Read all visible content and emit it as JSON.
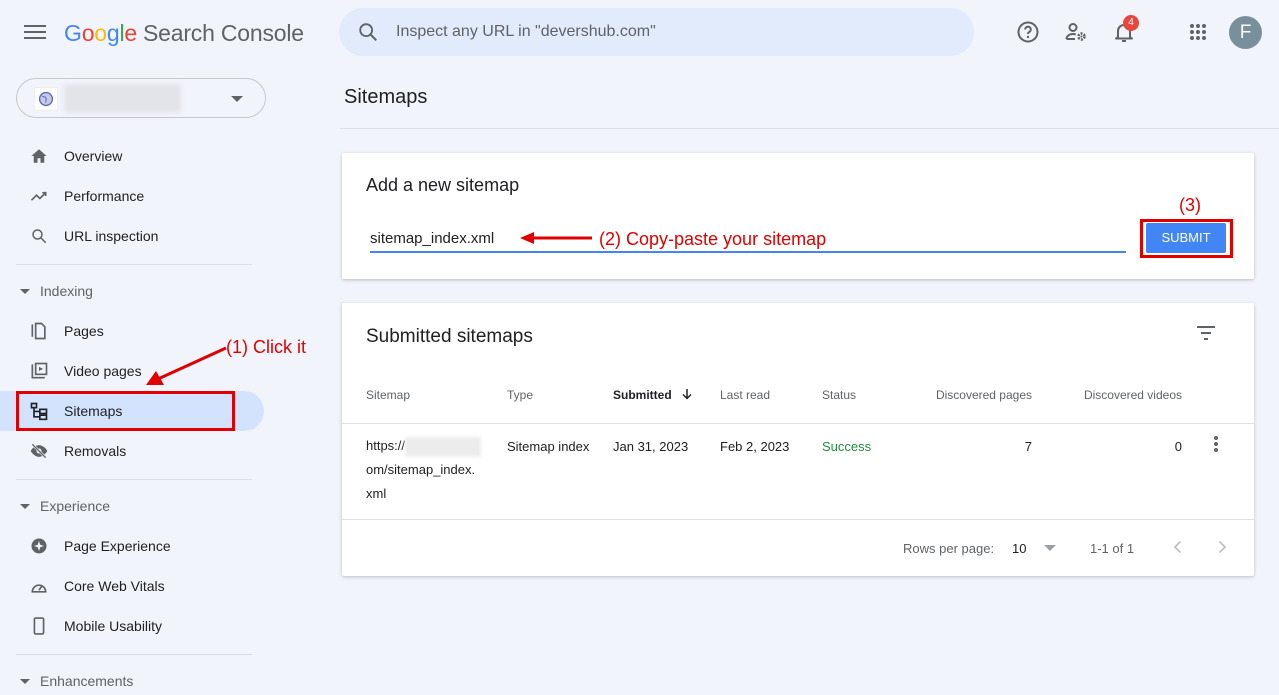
{
  "header": {
    "logo_google": [
      "G",
      "o",
      "o",
      "g",
      "l",
      "e"
    ],
    "logo_product": "Search Console",
    "search_placeholder": "Inspect any URL in \"devershub.com\"",
    "notification_count": "4",
    "avatar_initial": "F",
    "icons": [
      "menu-icon",
      "search-icon",
      "help-icon",
      "manage-users-icon",
      "notifications-icon",
      "apps-icon"
    ]
  },
  "property_selector": {
    "icon": "globe-icon",
    "value_obscured": true
  },
  "sidebar": {
    "items_top": [
      {
        "label": "Overview",
        "icon": "home-icon"
      },
      {
        "label": "Performance",
        "icon": "trending-up-icon"
      },
      {
        "label": "URL inspection",
        "icon": "search-icon"
      }
    ],
    "sections": [
      {
        "label": "Indexing",
        "items": [
          {
            "label": "Pages",
            "icon": "pages-icon"
          },
          {
            "label": "Video pages",
            "icon": "video-pages-icon"
          },
          {
            "label": "Sitemaps",
            "icon": "sitemap-icon",
            "active": true
          },
          {
            "label": "Removals",
            "icon": "removals-icon"
          }
        ]
      },
      {
        "label": "Experience",
        "items": [
          {
            "label": "Page Experience",
            "icon": "page-experience-icon"
          },
          {
            "label": "Core Web Vitals",
            "icon": "speedometer-icon"
          },
          {
            "label": "Mobile Usability",
            "icon": "phone-icon"
          }
        ]
      },
      {
        "label": "Enhancements",
        "items": []
      }
    ]
  },
  "main": {
    "page_title": "Sitemaps",
    "add_card": {
      "title": "Add a new sitemap",
      "input_value": "sitemap_index.xml",
      "submit_label": "SUBMIT"
    },
    "submitted_card": {
      "title": "Submitted sitemaps",
      "columns": [
        "Sitemap",
        "Type",
        "Submitted",
        "Last read",
        "Status",
        "Discovered pages",
        "Discovered videos"
      ],
      "sorted_column": "Submitted",
      "rows": [
        {
          "sitemap_prefix": "https://",
          "sitemap_line2": "om/sitemap_index.",
          "sitemap_line3": "xml",
          "type": "Sitemap index",
          "submitted": "Jan 31, 2023",
          "last_read": "Feb 2, 2023",
          "status": "Success",
          "discovered_pages": "7",
          "discovered_videos": "0"
        }
      ],
      "footer": {
        "rows_per_page_label": "Rows per page:",
        "rows_per_page_value": "10",
        "range": "1-1 of 1"
      }
    }
  },
  "annotations": {
    "step1": "(1) Click it",
    "step2": "(2) Copy-paste your sitemap",
    "step3": "(3)",
    "color": "#e00000"
  },
  "colors": {
    "accent": "#4285f4",
    "success": "#1e8e3e",
    "active_nav": "#d3e3fd",
    "background": "#f1f4fb",
    "badge": "#e8453c"
  }
}
